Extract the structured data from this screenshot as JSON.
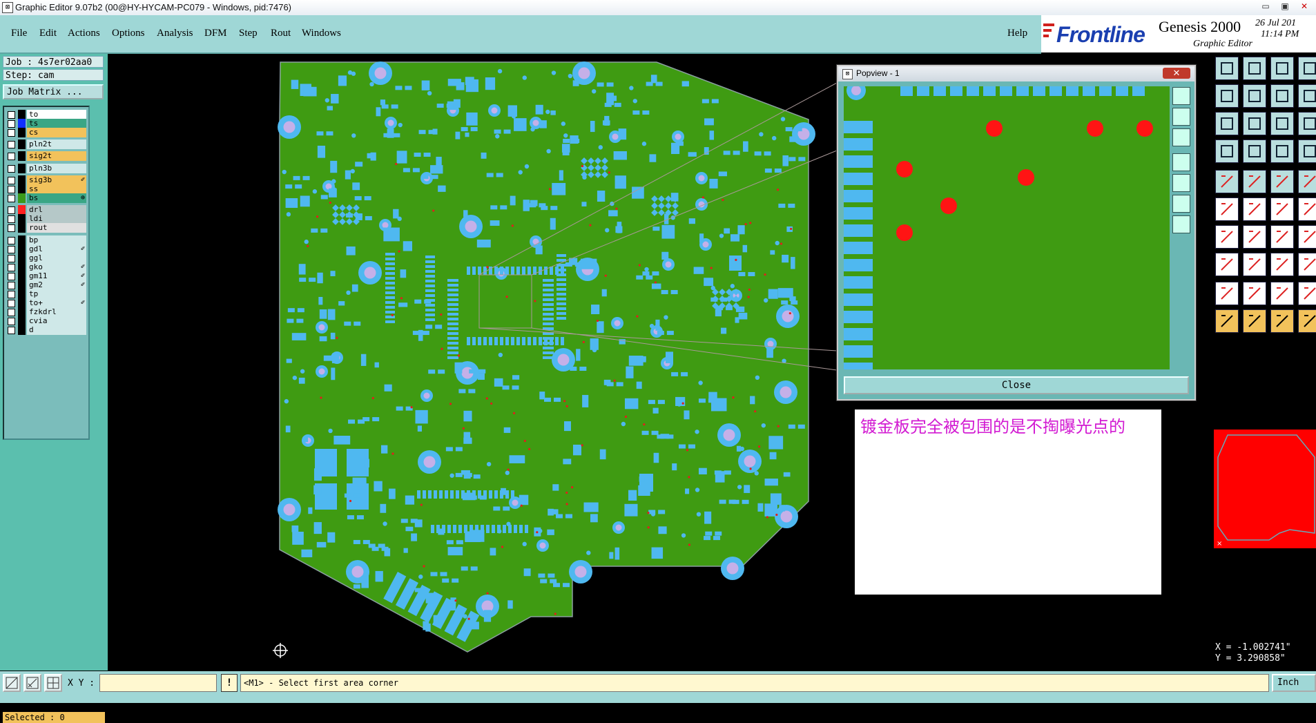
{
  "window": {
    "title": "Graphic Editor 9.07b2 (00@HY-HYCAM-PC079 - Windows, pid:7476)",
    "min_label": "▭",
    "max_label": "▣",
    "close_label": "✕"
  },
  "menu": {
    "items": [
      "File",
      "Edit",
      "Actions",
      "Options",
      "Analysis",
      "DFM",
      "Step",
      "Rout",
      "Windows"
    ],
    "help": "Help"
  },
  "logo": {
    "brand": "Frontline",
    "product": "Genesis 2000",
    "subtitle": "Graphic Editor",
    "date": "26 Jul 201",
    "time": "11:14 PM"
  },
  "left_panel": {
    "job": "Job : 4s7er02aa0",
    "step": "Step: cam",
    "job_matrix": "Job Matrix ...",
    "layers": [
      {
        "name": "to",
        "swatch": "#000000",
        "bg": "#ffffff",
        "mark": ""
      },
      {
        "name": "ts",
        "swatch": "#1030ff",
        "bg": "#3aa685",
        "mark": ""
      },
      {
        "name": "cs",
        "swatch": "#000000",
        "bg": "#f2c25b",
        "mark": ""
      },
      {
        "name": "pln2t",
        "swatch": "#000000",
        "bg": "#cfe8e8",
        "mark": ""
      },
      {
        "name": "sig2t",
        "swatch": "#000000",
        "bg": "#f2c25b",
        "mark": ""
      },
      {
        "name": "pln3b",
        "swatch": "#000000",
        "bg": "#cfe8e8",
        "mark": ""
      },
      {
        "name": "sig3b",
        "swatch": "#000000",
        "bg": "#f2c25b",
        "mark": "✐"
      },
      {
        "name": "ss",
        "swatch": "#000000",
        "bg": "#f2c25b",
        "mark": ""
      },
      {
        "name": "bs",
        "swatch": "#3a9a1a",
        "bg": "#3aa685",
        "mark": "⊕"
      },
      {
        "name": "drl",
        "swatch": "#ff2020",
        "bg": "#b5c8c8",
        "mark": ""
      },
      {
        "name": "ldi",
        "swatch": "#000000",
        "bg": "#b5c8c8",
        "mark": ""
      },
      {
        "name": "rout",
        "swatch": "#000000",
        "bg": "#e0e0e0",
        "mark": ""
      },
      {
        "name": "bp",
        "swatch": "#000000",
        "bg": "#cfe8e8",
        "mark": ""
      },
      {
        "name": "gdl",
        "swatch": "#000000",
        "bg": "#cfe8e8",
        "mark": "✐"
      },
      {
        "name": "ggl",
        "swatch": "#000000",
        "bg": "#cfe8e8",
        "mark": ""
      },
      {
        "name": "gko",
        "swatch": "#000000",
        "bg": "#cfe8e8",
        "mark": "✐"
      },
      {
        "name": "gm11",
        "swatch": "#000000",
        "bg": "#cfe8e8",
        "mark": "✐"
      },
      {
        "name": "gm2",
        "swatch": "#000000",
        "bg": "#cfe8e8",
        "mark": "✐"
      },
      {
        "name": "tp",
        "swatch": "#000000",
        "bg": "#cfe8e8",
        "mark": ""
      },
      {
        "name": "to+",
        "swatch": "#000000",
        "bg": "#cfe8e8",
        "mark": "✐"
      },
      {
        "name": "fzkdrl",
        "swatch": "#000000",
        "bg": "#cfe8e8",
        "mark": ""
      },
      {
        "name": "cvia",
        "swatch": "#000000",
        "bg": "#cfe8e8",
        "mark": ""
      },
      {
        "name": "d",
        "swatch": "#000000",
        "bg": "#cfe8e8",
        "mark": ""
      }
    ],
    "selected": "Selected : 0"
  },
  "popview": {
    "title": "Popview - 1",
    "close_x": "✕",
    "close_button": "Close"
  },
  "note": {
    "text": "镀金板完全被包围的是不掏曝光点的"
  },
  "coords": {
    "x": "X = -1.002741\"",
    "y": "Y = 3.290858\""
  },
  "bottom": {
    "xy_label": "X Y :",
    "xy_value": "",
    "warn": "!",
    "status": "<M1> - Select first area corner",
    "unit": "Inch"
  },
  "colors": {
    "board": "#3f9b12",
    "pad": "#4fb8f0",
    "via_ring": "#4fb8f0",
    "via_hole": "#c5b0e8",
    "drill": "#e0201c",
    "panel": "#9fd7d6"
  }
}
